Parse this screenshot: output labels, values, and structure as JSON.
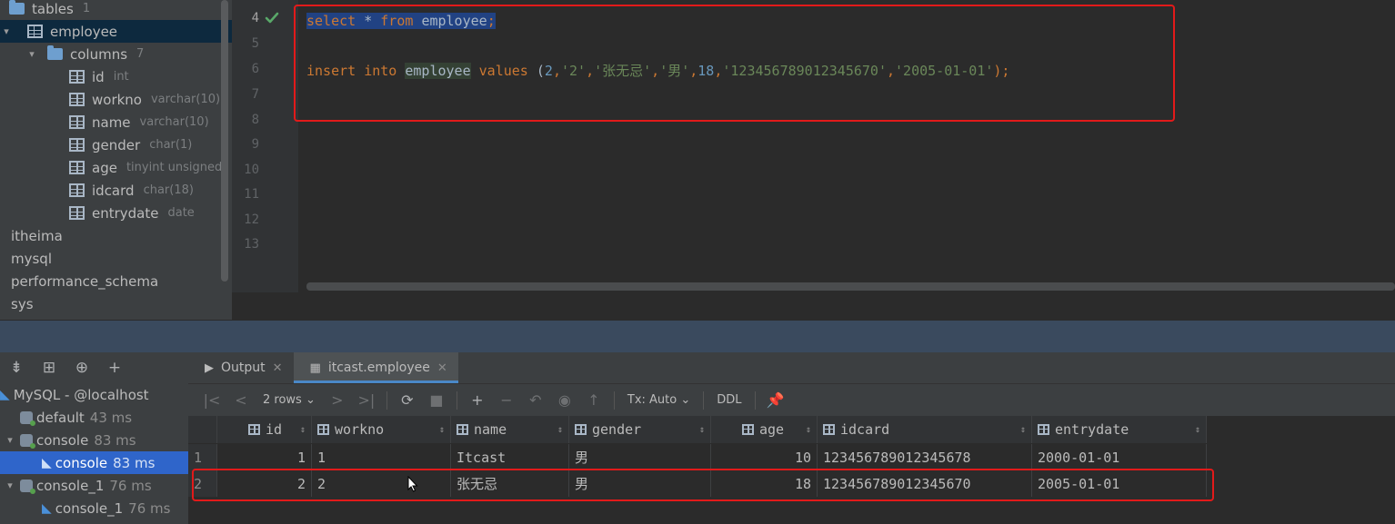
{
  "db_tree": {
    "rows": [
      {
        "label": "tables",
        "hint": "1",
        "arrow": "",
        "icon": "folder-icon"
      },
      {
        "label": "employee",
        "hint": "",
        "arrow": "▾",
        "icon": "table-icon"
      },
      {
        "label": "columns",
        "hint": "7",
        "arrow": "▾",
        "icon": "folder-icon"
      },
      {
        "label": "id",
        "hint": "int",
        "icon": "column-icon"
      },
      {
        "label": "workno",
        "hint": "varchar(10)",
        "icon": "column-icon"
      },
      {
        "label": "name",
        "hint": "varchar(10)",
        "icon": "column-icon"
      },
      {
        "label": "gender",
        "hint": "char(1)",
        "icon": "column-icon"
      },
      {
        "label": "age",
        "hint": "tinyint unsigned",
        "icon": "column-icon"
      },
      {
        "label": "idcard",
        "hint": "char(18)",
        "icon": "column-icon"
      },
      {
        "label": "entrydate",
        "hint": "date",
        "icon": "column-icon"
      },
      {
        "label": "itheima",
        "hint": ""
      },
      {
        "label": "mysql",
        "hint": ""
      },
      {
        "label": "performance_schema",
        "hint": ""
      },
      {
        "label": "sys",
        "hint": ""
      }
    ]
  },
  "editor": {
    "line_numbers": [
      "4",
      "5",
      "6",
      "7",
      "8",
      "9",
      "10",
      "11",
      "12",
      "13"
    ],
    "select_stmt": {
      "kw1": "select",
      "star": " * ",
      "kw2": "from",
      "table": "employee",
      "end": ";"
    },
    "insert_stmt": {
      "kw1": "insert",
      "kw2": "into",
      "table": "employee",
      "kw3": "values",
      "open": " (",
      "v1": "2",
      "v2": "'2'",
      "v3": "'张无忌'",
      "v4": "'男'",
      "v5": "18",
      "v6": "'123456789012345670'",
      "v7": "'2005-01-01'",
      "close": ");",
      "comma": ","
    }
  },
  "services": {
    "toolbar_icons": [
      "collapse-icon",
      "group-icon",
      "add-view-icon",
      "add-icon"
    ],
    "rows": [
      {
        "label": "MySQL - @localhost",
        "ms": ""
      },
      {
        "label": "default",
        "ms": "43 ms"
      },
      {
        "label": "console",
        "ms": "83 ms"
      },
      {
        "label": "console",
        "ms": "83 ms"
      },
      {
        "label": "console_1",
        "ms": "76 ms"
      },
      {
        "label": "console_1",
        "ms": "76 ms"
      }
    ]
  },
  "results": {
    "tabs": [
      {
        "label": "Output",
        "icon": "output-icon"
      },
      {
        "label": "itcast.employee",
        "icon": "table-icon"
      }
    ],
    "toolbar": {
      "rows": "2 rows",
      "tx": "Tx: Auto",
      "ddl": "DDL"
    },
    "columns": [
      "id",
      "workno",
      "name",
      "gender",
      "age",
      "idcard",
      "entrydate"
    ],
    "rows": [
      {
        "num": "1",
        "id": "1",
        "workno": "1",
        "name": "Itcast",
        "gender": "男",
        "age": "10",
        "idcard": "123456789012345678",
        "entrydate": "2000-01-01"
      },
      {
        "num": "2",
        "id": "2",
        "workno": "2",
        "name": "张无忌",
        "gender": "男",
        "age": "18",
        "idcard": "123456789012345670",
        "entrydate": "2005-01-01"
      }
    ]
  },
  "colors": {
    "highlight_red": "#e21a1a",
    "selection_blue": "#2f65ca"
  }
}
